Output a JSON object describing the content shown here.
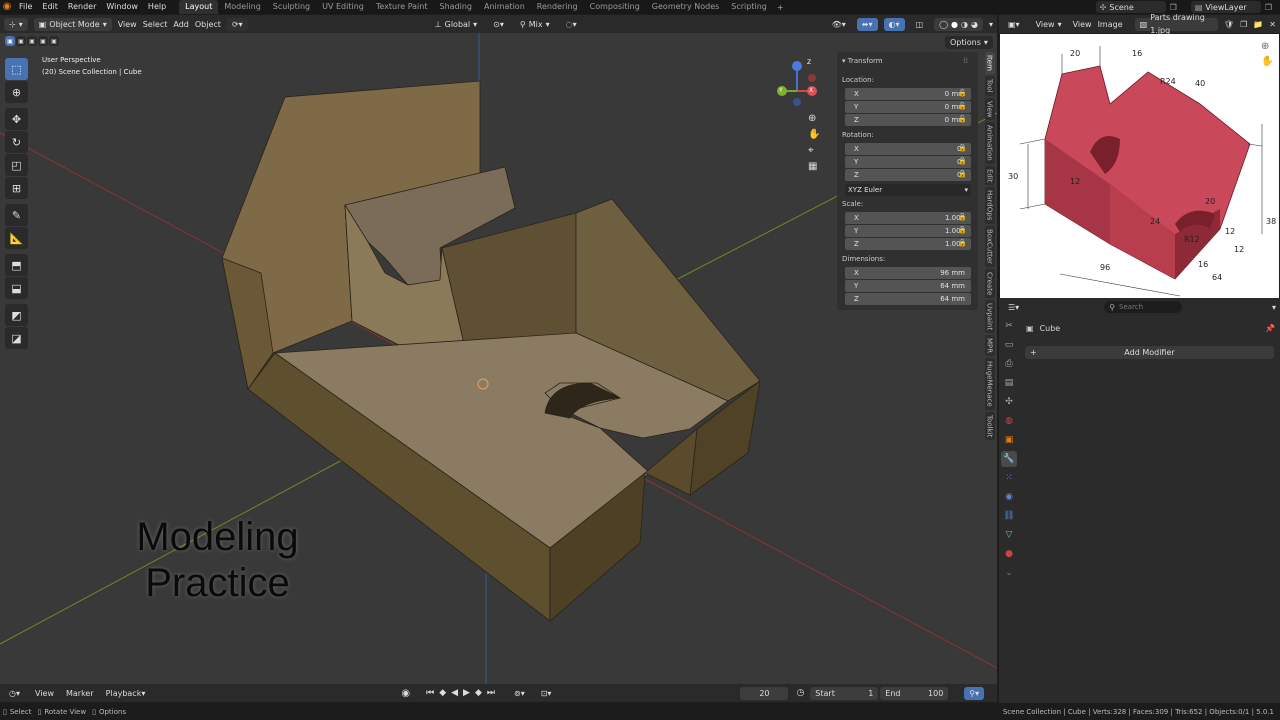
{
  "topbar": {
    "menus": [
      "File",
      "Edit",
      "Render",
      "Window",
      "Help"
    ],
    "workspaces": [
      "Layout",
      "Modeling",
      "Sculpting",
      "UV Editing",
      "Texture Paint",
      "Shading",
      "Animation",
      "Rendering",
      "Compositing",
      "Geometry Nodes",
      "Scripting"
    ],
    "active_workspace": "Layout",
    "add_tab": "+",
    "scene": "Scene",
    "view_layer": "ViewLayer"
  },
  "viewport_header": {
    "mode": "Object Mode",
    "menus": [
      "View",
      "Select",
      "Add",
      "Object"
    ],
    "orientation": "Global",
    "snap_mode": "Mix",
    "options": "Options"
  },
  "viewport": {
    "perspective": "User Perspective",
    "collection": "(20) Scene Collection | Cube",
    "overlay_title_line1": "Modeling",
    "overlay_title_line2": "Practice",
    "gizmo": {
      "x": "X",
      "y": "Y",
      "z": "Z"
    }
  },
  "tools": [
    "select-box",
    "cursor",
    "move",
    "rotate",
    "scale",
    "transform",
    "annotate",
    "measure",
    "add-cube",
    "extrude",
    "shear",
    "primitive"
  ],
  "npanel": {
    "title": "Transform",
    "location_label": "Location:",
    "location": [
      {
        "axis": "X",
        "value": "0 mm"
      },
      {
        "axis": "Y",
        "value": "0 mm"
      },
      {
        "axis": "Z",
        "value": "0 mm"
      }
    ],
    "rotation_label": "Rotation:",
    "rotation": [
      {
        "axis": "X",
        "value": "0°"
      },
      {
        "axis": "Y",
        "value": "0°"
      },
      {
        "axis": "Z",
        "value": "0°"
      }
    ],
    "rotation_mode": "XYZ Euler",
    "scale_label": "Scale:",
    "scale": [
      {
        "axis": "X",
        "value": "1.000"
      },
      {
        "axis": "Y",
        "value": "1.000"
      },
      {
        "axis": "Z",
        "value": "1.000"
      }
    ],
    "dimensions_label": "Dimensions:",
    "dimensions": [
      {
        "axis": "X",
        "value": "96 mm"
      },
      {
        "axis": "Y",
        "value": "64 mm"
      },
      {
        "axis": "Z",
        "value": "64 mm"
      }
    ]
  },
  "sidebar_tabs": [
    "Item",
    "Tool",
    "View",
    "Animation",
    "Edit",
    "HardOps",
    "BoxCutter",
    "Create",
    "Uvpaint",
    "MPR",
    "HugeMenace",
    "Toolkit"
  ],
  "timeline": {
    "menus": [
      "View",
      "Marker",
      "Playback"
    ],
    "current_frame": "20",
    "start_label": "Start",
    "start": "1",
    "end_label": "End",
    "end": "100"
  },
  "image_editor": {
    "menus": [
      "View",
      "View",
      "Image"
    ],
    "image_name": "Parts drawing 1.jpg",
    "dimensions_shown": [
      "20",
      "16",
      "40",
      "R24",
      "30",
      "12",
      "20",
      "24",
      "96",
      "16",
      "64",
      "12",
      "38",
      "R12",
      "12"
    ]
  },
  "properties": {
    "search_placeholder": "Search",
    "object_name": "Cube",
    "add_modifier": "Add Modifier"
  },
  "status": {
    "select": "Select",
    "rotate_view": "Rotate View",
    "options": "Options",
    "stats": "Scene Collection | Cube | Verts:328 | Faces:309 | Tris:652 | Objects:0/1 | 5.0.1"
  },
  "colors": {
    "accent": "#4772b3",
    "brand": "#e87d0d",
    "model": "#7a6a4a",
    "drawing_red": "#c9485a"
  }
}
